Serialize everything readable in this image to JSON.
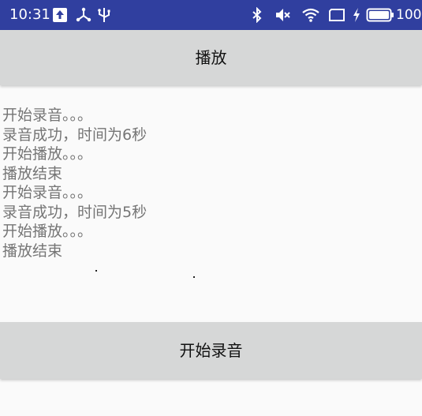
{
  "status_bar": {
    "time": "10:31",
    "battery_level": "100",
    "icons": [
      "upload-icon",
      "usb-tree-icon",
      "usb-icon",
      "bluetooth-icon",
      "mute-icon",
      "wifi-icon",
      "screen-rotate-icon",
      "charging-icon",
      "battery-icon"
    ],
    "background": "#303f9f"
  },
  "play_button": {
    "label": "播放"
  },
  "log": {
    "lines": [
      "开始录音。。。",
      "录音成功，时间为6秒",
      "开始播放。。。",
      "播放结束",
      "开始录音。。。",
      "录音成功，时间为5秒",
      "开始播放。。。",
      "播放结束"
    ]
  },
  "record_button": {
    "label": "开始录音"
  }
}
